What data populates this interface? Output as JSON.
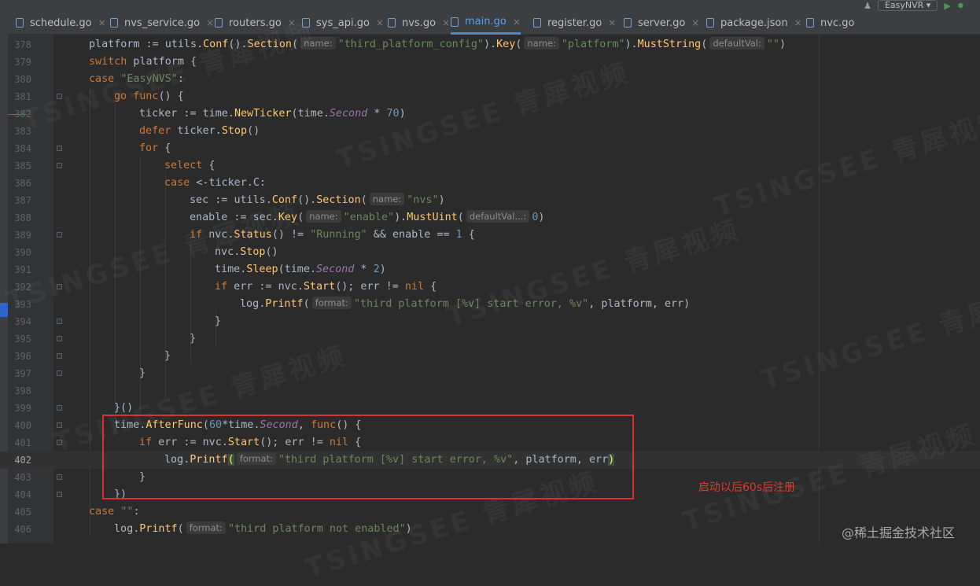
{
  "tabs": [
    {
      "label": "schedule.go",
      "active": false,
      "closable": true
    },
    {
      "label": "nvs_service.go",
      "active": false,
      "closable": true
    },
    {
      "label": "routers.go",
      "active": false,
      "closable": true
    },
    {
      "label": "sys_api.go",
      "active": false,
      "closable": true
    },
    {
      "label": "nvs.go",
      "active": false,
      "closable": true
    },
    {
      "label": "main.go",
      "active": true,
      "closable": true
    },
    {
      "label": "register.go",
      "active": false,
      "closable": true
    },
    {
      "label": "server.go",
      "active": false,
      "closable": true
    },
    {
      "label": "package.json",
      "active": false,
      "closable": true
    },
    {
      "label": "nvc.go",
      "active": false,
      "closable": false
    }
  ],
  "toolbar": {
    "run_config": "EasyNVR"
  },
  "line_numbers": [
    "378",
    "379",
    "380",
    "381",
    "382",
    "383",
    "384",
    "385",
    "386",
    "387",
    "388",
    "389",
    "390",
    "391",
    "392",
    "393",
    "394",
    "395",
    "396",
    "397",
    "398",
    "399",
    "400",
    "401",
    "402",
    "403",
    "404",
    "405",
    "406"
  ],
  "current_line": "402",
  "hints": {
    "name": "name:",
    "defaultVal": "defaultVal:",
    "defaultVal_short": "defaultVal...:",
    "format": "format:"
  },
  "annotation": "启动以后60s后注册",
  "watermark": "TSINGSEE 青犀视频",
  "brand": "@稀土掘金技术社区",
  "colors": {
    "accent": "#4a88c7",
    "annotation": "#e03a2e",
    "keyword": "#cc7832",
    "string": "#6a8759",
    "number": "#6897bb"
  }
}
